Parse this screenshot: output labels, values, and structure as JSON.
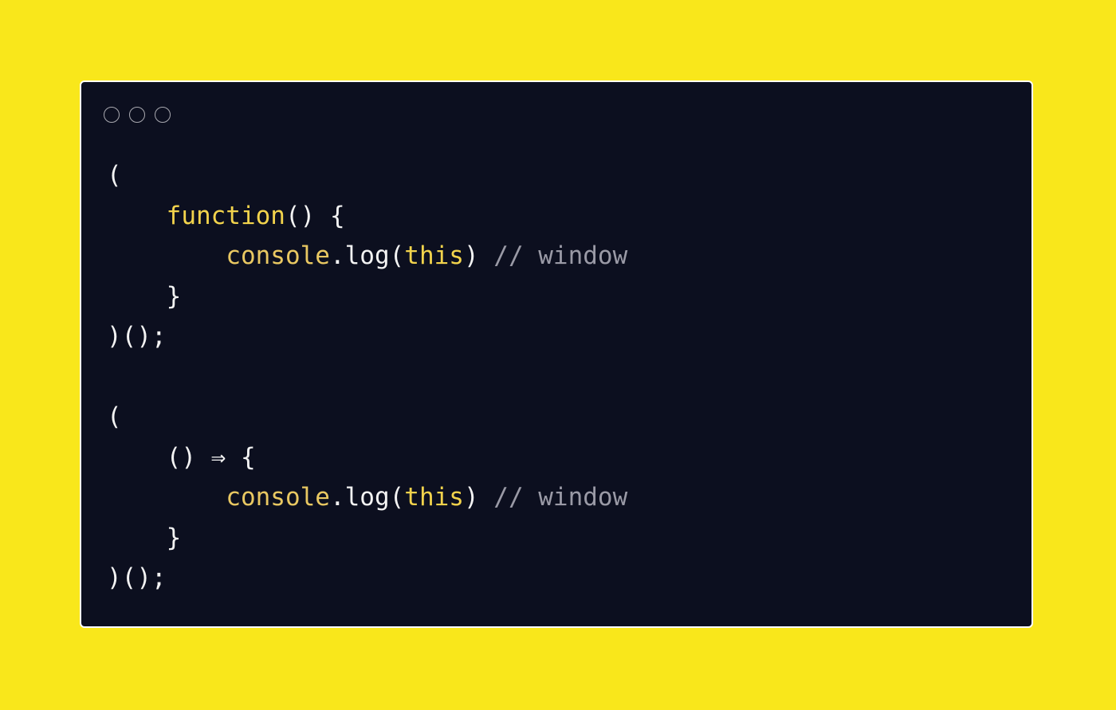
{
  "window": {
    "controls": [
      "close-dot",
      "minimize-dot",
      "maximize-dot"
    ]
  },
  "code": {
    "lines": [
      {
        "indent": "",
        "tokens": [
          {
            "t": "pn",
            "v": "("
          }
        ]
      },
      {
        "indent": "    ",
        "tokens": [
          {
            "t": "kw",
            "v": "function"
          },
          {
            "t": "pn",
            "v": "() {"
          }
        ]
      },
      {
        "indent": "        ",
        "tokens": [
          {
            "t": "fn",
            "v": "console"
          },
          {
            "t": "pn",
            "v": ".log("
          },
          {
            "t": "kw",
            "v": "this"
          },
          {
            "t": "pn",
            "v": ") "
          },
          {
            "t": "cm",
            "v": "// window"
          }
        ]
      },
      {
        "indent": "    ",
        "tokens": [
          {
            "t": "pn",
            "v": "}"
          }
        ]
      },
      {
        "indent": "",
        "tokens": [
          {
            "t": "pn",
            "v": ")();"
          }
        ]
      },
      {
        "indent": "",
        "tokens": []
      },
      {
        "indent": "",
        "tokens": [
          {
            "t": "pn",
            "v": "("
          }
        ]
      },
      {
        "indent": "    ",
        "tokens": [
          {
            "t": "pn",
            "v": "() ⇒ {"
          }
        ]
      },
      {
        "indent": "        ",
        "tokens": [
          {
            "t": "fn",
            "v": "console"
          },
          {
            "t": "pn",
            "v": ".log("
          },
          {
            "t": "kw",
            "v": "this"
          },
          {
            "t": "pn",
            "v": ") "
          },
          {
            "t": "cm",
            "v": "// window"
          }
        ]
      },
      {
        "indent": "    ",
        "tokens": [
          {
            "t": "pn",
            "v": "}"
          }
        ]
      },
      {
        "indent": "",
        "tokens": [
          {
            "t": "pn",
            "v": ")();"
          }
        ]
      }
    ]
  },
  "colors": {
    "page_background": "#f9e71b",
    "editor_background": "#0c0f1f",
    "keyword": "#f2d34c",
    "function_name": "#e9c862",
    "comment": "#9a9aa6",
    "punctuation": "#f3f3f3"
  }
}
